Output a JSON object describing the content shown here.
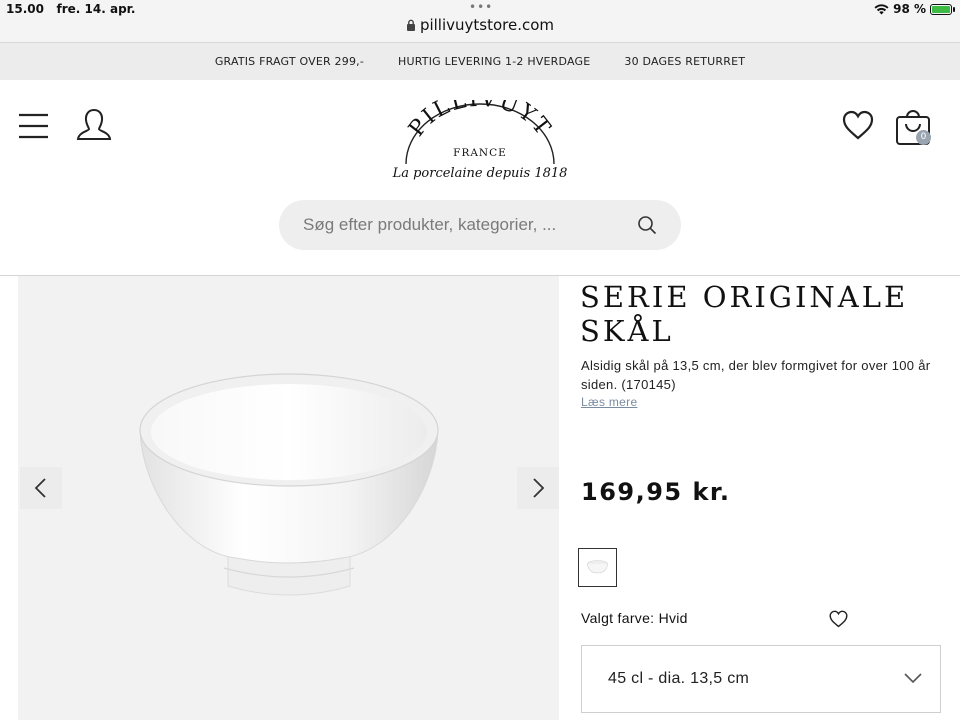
{
  "status_bar": {
    "time": "15.00",
    "date": "fre. 14. apr.",
    "battery": "98 %",
    "url": "pillivuytstore.com"
  },
  "promo": {
    "items": [
      "GRATIS FRAGT OVER 299,-",
      "HURTIG LEVERING 1-2 HVERDAGE",
      "30 DAGES RETURRET"
    ]
  },
  "header": {
    "logo_text": "PILLIVUYT",
    "logo_country": "FRANCE",
    "tagline": "La porcelaine depuis 1818",
    "cart_count": "0",
    "search_placeholder": "Søg efter produkter, kategorier, ..."
  },
  "product": {
    "title": "SERIE ORIGINALE SKÅL",
    "description": "Alsidig skål på 13,5 cm, der blev formgivet for over 100 år siden. (170145)",
    "read_more": "Læs mere",
    "price": "169,95 kr.",
    "selected_color": "Valgt farve: Hvid",
    "size": "45 cl - dia. 13,5 cm"
  },
  "icons": {
    "menu": "hamburger-menu-icon",
    "account": "user-icon",
    "wishlist": "heart-icon",
    "cart": "shopping-bag-icon",
    "search": "search-icon",
    "prev": "chevron-left-icon",
    "next": "chevron-right-icon",
    "dropdown": "chevron-down-icon"
  },
  "colors": {
    "promo_bg": "#ececec",
    "search_bg": "#eeeeee",
    "gallery_bg": "#f2f2f2",
    "link": "#7a8ca0",
    "battery": "#3dbb45"
  }
}
